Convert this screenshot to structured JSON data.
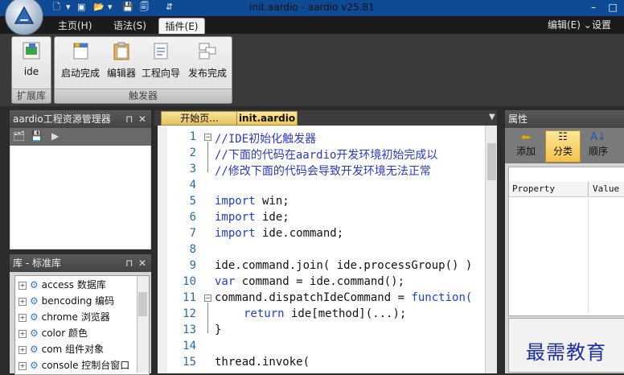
{
  "window": {
    "title": "init.aardio - aardio v25.81",
    "controls": [
      "–",
      "□"
    ]
  },
  "tabs": [
    {
      "label": "主页(H)"
    },
    {
      "label": "语法(S)"
    },
    {
      "label": "插件(E)"
    }
  ],
  "top_tools": {
    "edit": "编辑(E) ⌄",
    "settings": "设置(S)"
  },
  "ribbon": {
    "groups": [
      {
        "label": "扩展库",
        "buttons": [
          "ide"
        ]
      },
      {
        "label": "触发器",
        "buttons": [
          "启动完成",
          "编辑器",
          "工程向导",
          "发布完成"
        ]
      }
    ]
  },
  "project_panel": {
    "title": "aardio工程资源管理器",
    "pin": "⊓",
    "close": "✕"
  },
  "library_panel": {
    "title": "库 - 标准库",
    "pin": "⊓",
    "close": "✕",
    "items": [
      {
        "name": "access",
        "desc": "数据库"
      },
      {
        "name": "bencoding",
        "desc": "编码"
      },
      {
        "name": "chrome",
        "desc": "浏览器"
      },
      {
        "name": "color",
        "desc": "颜色"
      },
      {
        "name": "com",
        "desc": "组件对象"
      },
      {
        "name": "console",
        "desc": "控制台窗口"
      }
    ]
  },
  "editor": {
    "tabs": [
      {
        "label": "开始页..."
      },
      {
        "label": "init.aardio"
      }
    ],
    "lines": [
      "1",
      "2",
      "3",
      "4",
      "5",
      "6",
      "7",
      "8",
      "9",
      "10",
      "11",
      "12",
      "13",
      "14",
      "15"
    ],
    "code": {
      "l1": "//IDE初始化触发器",
      "l2": "//下面的代码在aardio开发环境初始完成以",
      "l3": "//修改下面的代码会导致开发环境无法正常",
      "l5_kw": "import",
      "l5_rest": " win;",
      "l6_kw": "import",
      "l6_rest": " ide;",
      "l7_kw": "import",
      "l7_rest": " ide.command;",
      "l9": "ide.command.join( ide.processGroup() )",
      "l10_kw": "var",
      "l10_rest": " command = ide.command();",
      "l11_a": "command.dispatchIdeCommand = ",
      "l11_kw": "function(",
      "l12_kw": "return",
      "l12_rest": " ide[method](...);",
      "l13": "}",
      "l15": "thread.invoke("
    }
  },
  "properties_panel": {
    "title": "属性",
    "toolbar": [
      "添加",
      "分类",
      "顺序"
    ],
    "columns": [
      "Property",
      "Value"
    ]
  },
  "watermark": "最需教育"
}
